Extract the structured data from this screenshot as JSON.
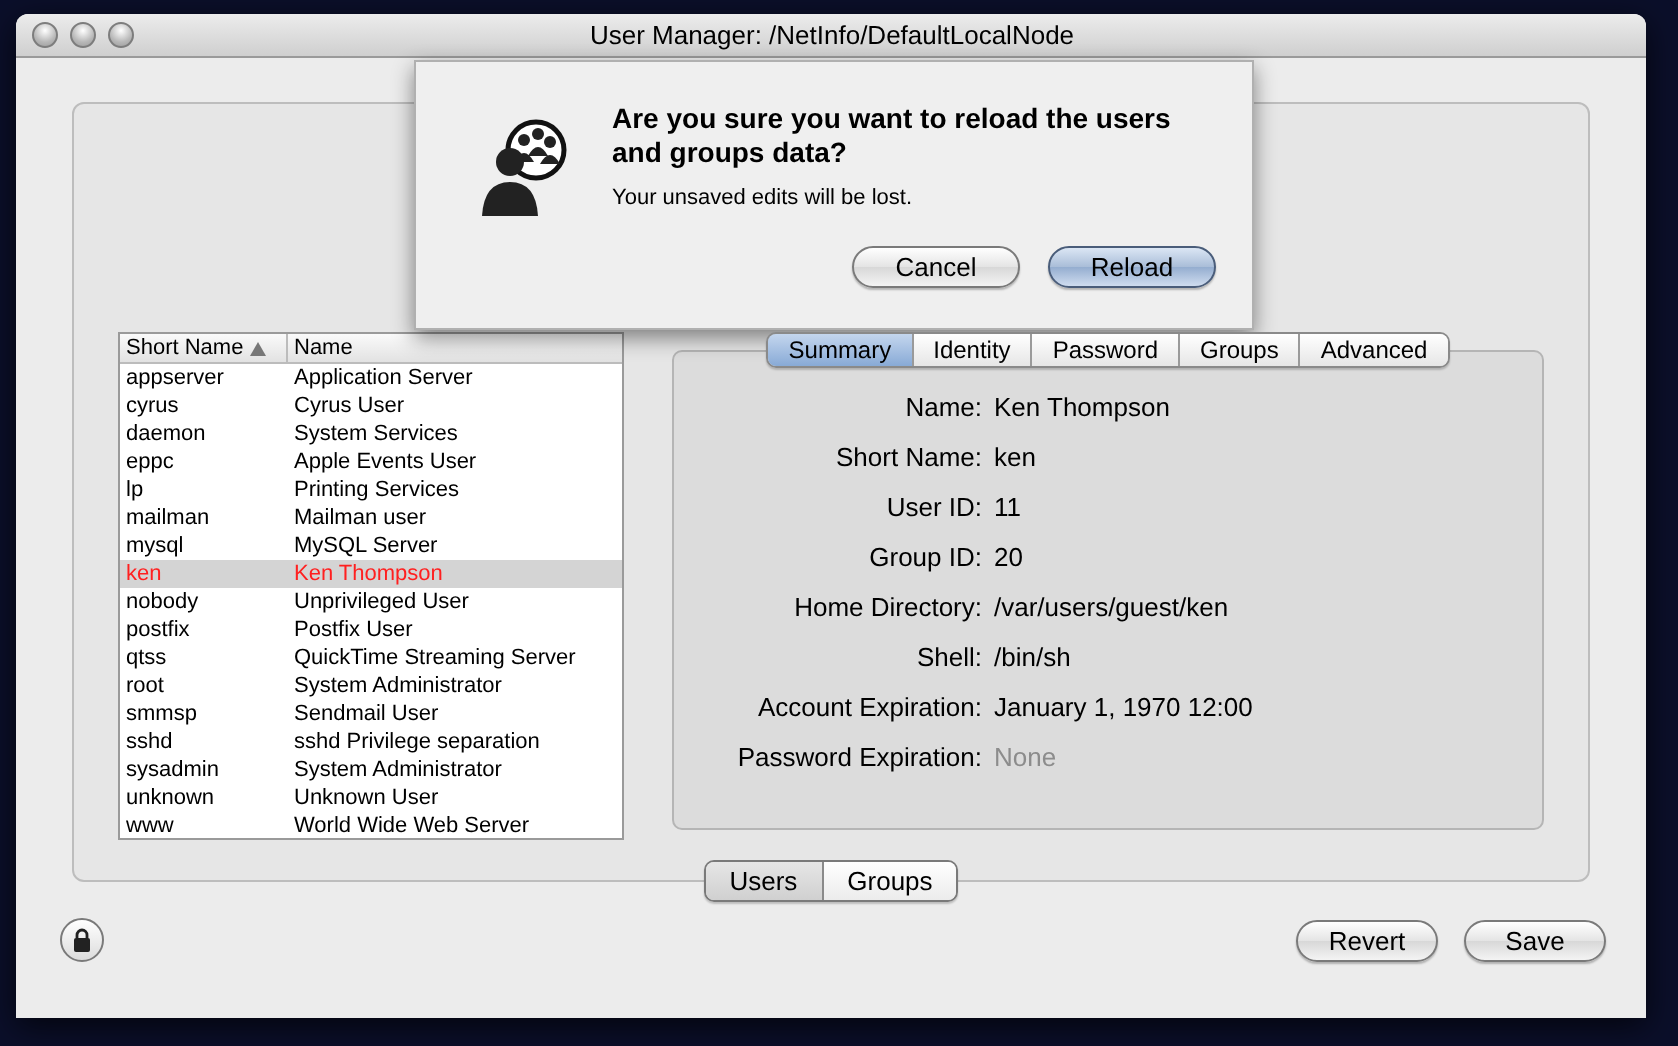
{
  "window": {
    "title": "User Manager: /NetInfo/DefaultLocalNode"
  },
  "dialog": {
    "title": "Are you sure you want to reload the users and groups data?",
    "message": "Your unsaved edits will be lost.",
    "buttons": [
      {
        "label": "Cancel",
        "default": false
      },
      {
        "label": "Reload",
        "default": true
      }
    ]
  },
  "user_list": {
    "columns": [
      {
        "label": "Short Name",
        "sorted": true
      },
      {
        "label": "Name",
        "sorted": false
      }
    ],
    "rows": [
      {
        "short_name": "appserver",
        "name": "Application Server",
        "selected": false
      },
      {
        "short_name": "cyrus",
        "name": "Cyrus User",
        "selected": false
      },
      {
        "short_name": "daemon",
        "name": "System Services",
        "selected": false
      },
      {
        "short_name": "eppc",
        "name": "Apple Events User",
        "selected": false
      },
      {
        "short_name": "lp",
        "name": "Printing Services",
        "selected": false
      },
      {
        "short_name": "mailman",
        "name": "Mailman user",
        "selected": false
      },
      {
        "short_name": "mysql",
        "name": "MySQL Server",
        "selected": false
      },
      {
        "short_name": "ken",
        "name": "Ken Thompson",
        "selected": true
      },
      {
        "short_name": "nobody",
        "name": "Unprivileged User",
        "selected": false
      },
      {
        "short_name": "postfix",
        "name": "Postfix User",
        "selected": false
      },
      {
        "short_name": "qtss",
        "name": "QuickTime Streaming Server",
        "selected": false
      },
      {
        "short_name": "root",
        "name": "System Administrator",
        "selected": false
      },
      {
        "short_name": "smmsp",
        "name": "Sendmail User",
        "selected": false
      },
      {
        "short_name": "sshd",
        "name": "sshd Privilege separation",
        "selected": false
      },
      {
        "short_name": "sysadmin",
        "name": "System Administrator",
        "selected": false
      },
      {
        "short_name": "unknown",
        "name": "Unknown User",
        "selected": false
      },
      {
        "short_name": "www",
        "name": "World Wide Web Server",
        "selected": false
      }
    ]
  },
  "detail_tabs": [
    {
      "label": "Summary",
      "selected": true
    },
    {
      "label": "Identity",
      "selected": false
    },
    {
      "label": "Password",
      "selected": false
    },
    {
      "label": "Groups",
      "selected": false
    },
    {
      "label": "Advanced",
      "selected": false
    }
  ],
  "fields": [
    {
      "label": "Name:",
      "value": "Ken Thompson",
      "disabled": false
    },
    {
      "label": "Short Name:",
      "value": "ken",
      "disabled": false
    },
    {
      "label": "User ID:",
      "value": "11",
      "disabled": false
    },
    {
      "label": "Group ID:",
      "value": "20",
      "disabled": false
    },
    {
      "label": "Home Directory:",
      "value": "/var/users/guest/ken",
      "disabled": false
    },
    {
      "label": "Shell:",
      "value": "/bin/sh",
      "disabled": false
    },
    {
      "label": "Account Expiration:",
      "value": "January 1, 1970 12:00",
      "disabled": false
    },
    {
      "label": "Password Expiration:",
      "value": "None",
      "disabled": true
    }
  ],
  "view_switch": [
    {
      "label": "Users",
      "selected": true
    },
    {
      "label": "Groups",
      "selected": false
    }
  ],
  "footer_buttons": [
    "Revert",
    "Save"
  ]
}
